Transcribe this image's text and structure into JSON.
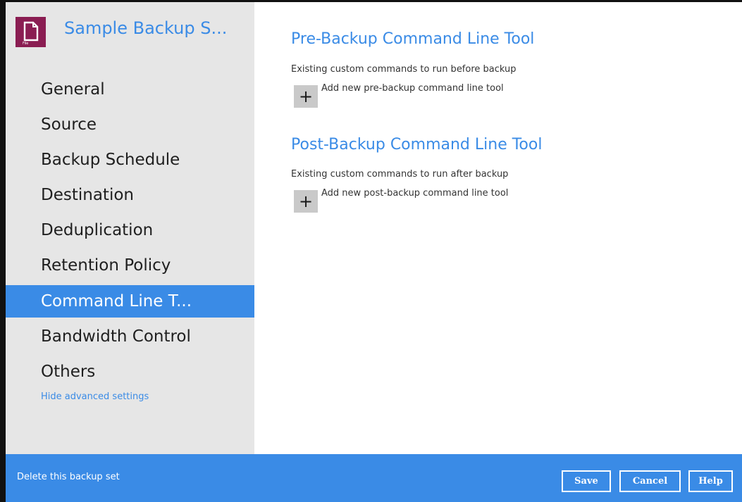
{
  "app": {
    "title": "Sample Backup S...",
    "logo_label": "File",
    "logo_icon": "file-icon",
    "accent_color": "#3a8be6",
    "logo_color": "#8a1d52"
  },
  "sidebar": {
    "items": [
      {
        "label": "General",
        "active": false
      },
      {
        "label": "Source",
        "active": false
      },
      {
        "label": "Backup Schedule",
        "active": false
      },
      {
        "label": "Destination",
        "active": false
      },
      {
        "label": "Deduplication",
        "active": false
      },
      {
        "label": "Retention Policy",
        "active": false
      },
      {
        "label": "Command Line T...",
        "active": true
      },
      {
        "label": "Bandwidth Control",
        "active": false
      },
      {
        "label": "Others",
        "active": false
      }
    ],
    "hide_advanced": "Hide advanced settings"
  },
  "main": {
    "pre": {
      "title": "Pre-Backup Command Line Tool",
      "description": "Existing custom commands to run before backup",
      "add_label": "Add new pre-backup command line tool",
      "add_icon": "plus-icon"
    },
    "post": {
      "title": "Post-Backup Command Line Tool",
      "description": "Existing custom commands to run after backup",
      "add_label": "Add new post-backup command line tool",
      "add_icon": "plus-icon"
    }
  },
  "footer": {
    "delete_label": "Delete this backup set",
    "save_label": "Save",
    "cancel_label": "Cancel",
    "help_label": "Help"
  }
}
